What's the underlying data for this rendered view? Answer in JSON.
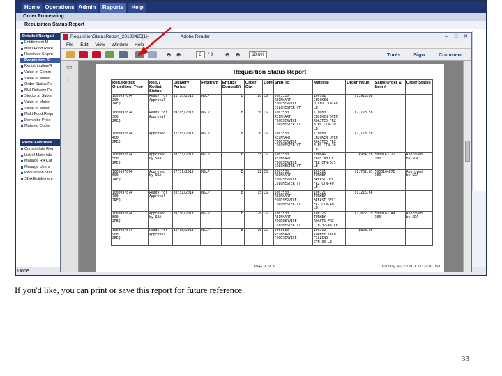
{
  "nav": {
    "tabs": [
      "Home",
      "Operations",
      "Admin",
      "Reports",
      "Help"
    ],
    "breadcrumb": "Order Processing",
    "subtitle": "Requisition Status Report"
  },
  "sidebar": {
    "detailed_heading": "Detailed Navigati",
    "detailed_items": [
      "Entitlement M",
      "Multi-Food Rece",
      "Received Shipm",
      "Requisition St",
      "Redistribution/R",
      "Value of Comm",
      "Value of Materi",
      "Order Status Re",
      "NW Delivery Ca",
      "Stocks at Subco",
      "Value of Materi",
      "Value of Materi",
      "Multi-Food Requ",
      "Domestic Price",
      "Material Outlay"
    ],
    "selected_index": 3,
    "portal_heading": "Portal Favorites",
    "portal_items": [
      "Consolidate Req",
      "List of Materials",
      "Manage RA Cat",
      "Manage Users",
      "Requisition Stat",
      "SDA Entitlement"
    ]
  },
  "statusbar": {
    "text": "Done"
  },
  "reader": {
    "title_left": "RequisitionStatusReport_20130425[1]-",
    "title_right": "Adobe Reader",
    "menus": [
      "File",
      "Edit",
      "View",
      "Window",
      "Help"
    ],
    "page_current": "3",
    "page_total": "/ 9",
    "zoom": "68.6%",
    "tool_labels": [
      "Tools",
      "Sign",
      "Comment"
    ],
    "toolbar_icons": [
      "open-icon",
      "create-pdf-icon",
      "upload-icon",
      "cloud-icon",
      "email-icon",
      "print-icon",
      "mail-icon"
    ],
    "min_glyph": "–",
    "max_glyph": "□",
    "close_glyph": "✕"
  },
  "report": {
    "title": "Requisition Status Report",
    "columns": [
      "Req./Redist. Order/Item Type",
      "Req. / Redist. Status",
      "Delivery Period",
      "Program",
      "Ent.(B) Bonus(B)",
      "Order Qty.",
      "UoM",
      "Ship-To",
      "Material",
      "Order value",
      "Sales Order & Item #",
      "Order Status"
    ],
    "rows": [
      [
        "1000097874\n200\nZREQ",
        "Ready for\nApproval",
        "11/30/2013",
        "NSLP",
        "E",
        "20",
        "CS",
        "5003530\nREINHART\nFOODSERVICE\nCOLCHESTER VT",
        "100101\nCHICKEN\nDICED CTN-40\nLB",
        "$1,928.88",
        "",
        ""
      ],
      [
        "1000097874\n300\nZREQ",
        "Ready for\nApproval",
        "09/15/2013",
        "NSLP",
        "E",
        "30",
        "CS",
        "5003530\nREINHART\nFOODSERVICE\nCOLCHESTER VT",
        "110080\nCHICKEN OVEN\nROASTED FRZ\n8 PC CTN-30\nLB",
        "$2,173.50",
        "",
        ""
      ],
      [
        "1000097874\n400\nZREQ",
        "Approved",
        "12/15/2013",
        "NSLP",
        "E",
        "30",
        "CS",
        "5003530\nREINHART\nFOODSERVICE\nCOLCHESTER VT",
        "110080\nCHICKEN OVEN\nROASTED FRZ\n8 PC CTN-30\nLB",
        "$2,173.50",
        "",
        ""
      ],
      [
        "1000097874\n500\nZREQ",
        "Approved\nby SDA",
        "08/31/2013",
        "NSLP",
        "E",
        "35",
        "CS",
        "5003530\nREINHART\nFOODSERVICE\nCOLCHESTER VT",
        "100046\nEGGS WHOLE\nFRZ CTN-6/5\nLB",
        "$934.50",
        "5000163721\n100",
        "Approved\nby SDA"
      ],
      [
        "1000097874\n600\nZREQ",
        "Approved\nby SDA",
        "07/31/2013",
        "NSLP",
        "E",
        "22",
        "CS",
        "5003530\nREINHART\nFOODSERVICE\nCOLCHESTER VT",
        "100121\nTURKEY\nBREAST DELI\nFRZ CTN-40\nLB",
        "$1,782.87",
        "5000164872\n100",
        "Approved\nby SDA"
      ],
      [
        "1000097874\n700\nZREQ",
        "Ready for\nApproval",
        "03/31/2014",
        "NSLP",
        "E",
        "15",
        "CS",
        "5003530\nREINHART\nFOODSERVICE\nCOLCHESTER VT",
        "100121\nTURKEY\nBREAST DELI\nFRZ CTN-40\nLB",
        "$1,215.66",
        "",
        ""
      ],
      [
        "1000097874\n800\nZREQ",
        "Approved\nby SDA",
        "09/30/2013",
        "NSLP",
        "E",
        "26",
        "CS",
        "5003530\nREINHART\nFOODSERVICE\nCOLCHESTER VT",
        "100125\nTURKEY\nROASTS FRZ\nCTN-32-48 LB",
        "$1,822.29",
        "5000163749\n100",
        "Approved\nby SDA"
      ],
      [
        "1000097874\n900\nZREQ",
        "Ready for\nApproval",
        "12/15/2013",
        "NSLP",
        "E",
        "15",
        "CS",
        "5003530\nREINHART\nFOODSERVICE",
        "100119\nTURKEY TACO\nFILLING\nCTN-30 LB",
        "$828.00",
        "",
        ""
      ]
    ],
    "footer_page": "Page 3 of 9",
    "footer_date": "Thursday 04/25/2013 11:23:01 CST"
  },
  "caption": "If you'd like, you can print or save this report for future reference.",
  "slide_number": "33",
  "colors": {
    "nav": "#1f3570",
    "arrow": "#cc1111",
    "reader_gray": "#818181"
  }
}
